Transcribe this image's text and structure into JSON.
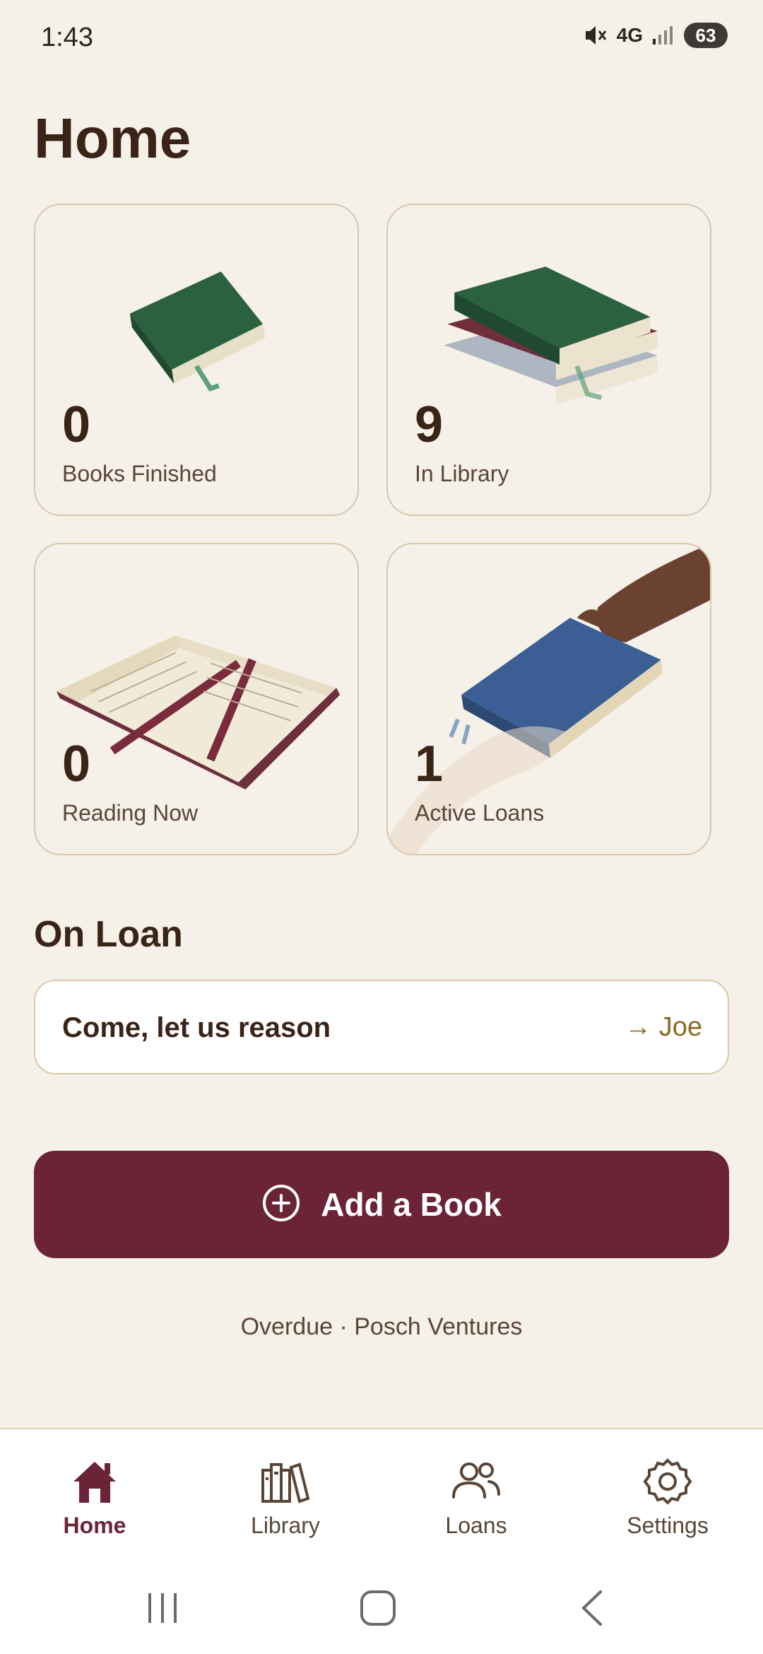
{
  "status_bar": {
    "time": "1:43",
    "network": "4G",
    "battery": "63"
  },
  "page": {
    "title": "Home"
  },
  "stats": [
    {
      "value": "0",
      "label": "Books Finished"
    },
    {
      "value": "9",
      "label": "In Library"
    },
    {
      "value": "0",
      "label": "Reading Now"
    },
    {
      "value": "1",
      "label": "Active Loans"
    }
  ],
  "on_loan": {
    "title": "On Loan",
    "items": [
      {
        "title": "Come, let us reason",
        "borrower": "→ Joe"
      }
    ]
  },
  "add_button": {
    "label": "Add a Book",
    "icon": "plus-circle-icon"
  },
  "footer": {
    "text": "Overdue · Posch Ventures"
  },
  "nav": {
    "items": [
      {
        "label": "Home",
        "icon": "home-icon",
        "active": true
      },
      {
        "label": "Library",
        "icon": "library-icon",
        "active": false
      },
      {
        "label": "Loans",
        "icon": "people-icon",
        "active": false
      },
      {
        "label": "Settings",
        "icon": "gear-icon",
        "active": false
      }
    ]
  },
  "colors": {
    "background": "#f5f0e8",
    "primary": "#6b2437",
    "text": "#3a2418",
    "accent": "#8a6a1e",
    "card_border": "#d9c9ad"
  }
}
